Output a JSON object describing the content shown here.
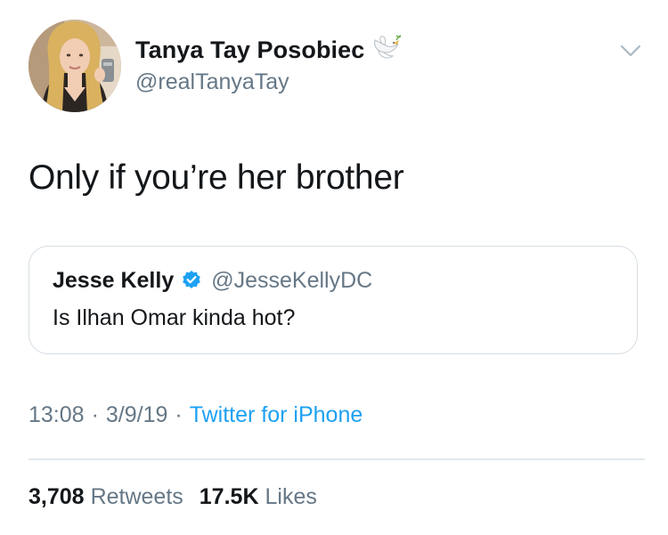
{
  "tweet": {
    "author": {
      "display_name": "Tanya Tay Posobiec",
      "handle": "@realTanyaTay",
      "name_emoji": "dove-icon"
    },
    "text": "Only if you’re her brother",
    "quoted": {
      "display_name": "Jesse Kelly",
      "handle": "@JesseKellyDC",
      "verified": true,
      "text": "Is Ilhan Omar kinda hot?"
    },
    "time": "13:08",
    "date": "3/9/19",
    "separator": "·",
    "source": "Twitter for iPhone",
    "stats": {
      "retweets_count": "3,708",
      "retweets_label": "Retweets",
      "likes_count": "17.5K",
      "likes_label": "Likes"
    }
  },
  "colors": {
    "text": "#14171a",
    "secondary": "#657786",
    "link": "#1da1f2",
    "border": "#d6dde3"
  }
}
